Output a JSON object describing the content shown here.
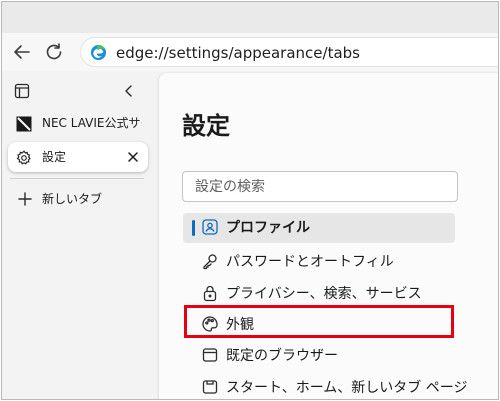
{
  "browser": {
    "address_url": "edge://settings/appearance/tabs"
  },
  "sidebar": {
    "tabs": [
      {
        "label": "NEC LAVIE公式サイ"
      },
      {
        "label": "設定"
      }
    ],
    "new_tab_label": "新しいタブ"
  },
  "settings": {
    "title": "設定",
    "search_placeholder": "設定の検索",
    "nav_items": [
      {
        "label": "プロファイル",
        "icon": "profile-icon",
        "active": true
      },
      {
        "label": "パスワードとオートフィル",
        "icon": "key-icon"
      },
      {
        "label": "プライバシー、検索、サービス",
        "icon": "lock-icon"
      },
      {
        "label": "外観",
        "icon": "palette-icon",
        "highlighted": true
      },
      {
        "label": "既定のブラウザー",
        "icon": "browser-window-icon"
      },
      {
        "label": "スタート、ホーム、新しいタブ ページ",
        "icon": "home-window-icon"
      }
    ]
  },
  "colors": {
    "active_indicator": "#0f6cbd",
    "highlight_box": "#e60012"
  }
}
